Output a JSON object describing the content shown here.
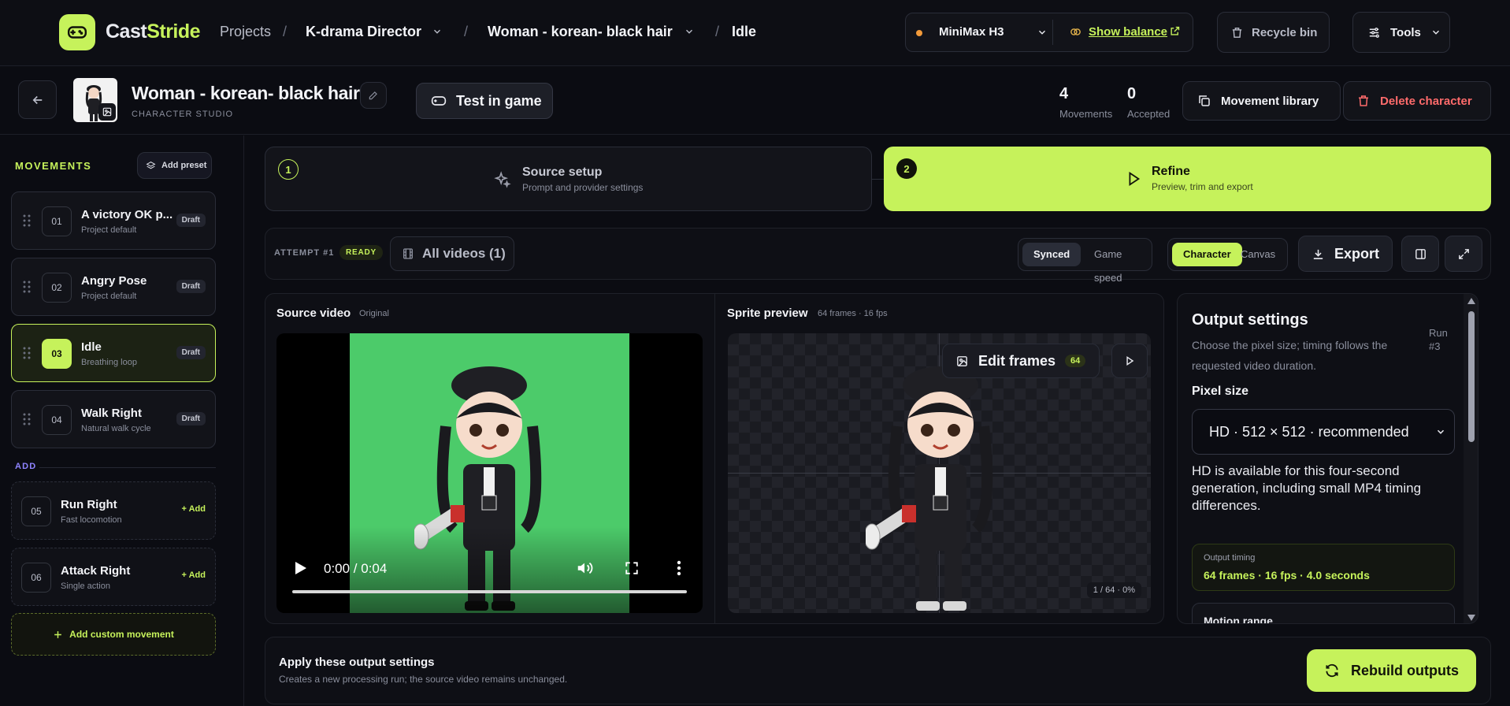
{
  "brand": {
    "part1": "Cast",
    "part2": "Stride"
  },
  "breadcrumb": {
    "projects": "Projects",
    "project": "K-drama Director",
    "character": "Woman - korean- black hair",
    "movement": "Idle"
  },
  "topbar": {
    "model": "MiniMax H3",
    "balance": "Show balance",
    "recycle": "Recycle bin",
    "tools": "Tools"
  },
  "character": {
    "name": "Woman - korean- black hair",
    "subtitle": "CHARACTER STUDIO",
    "test": "Test in game",
    "movements_count": "4",
    "movements_label": "Movements",
    "accepted_count": "0",
    "accepted_label": "Accepted",
    "library": "Movement library",
    "delete": "Delete character"
  },
  "sidebar": {
    "title": "MOVEMENTS",
    "add_preset": "Add preset",
    "items": [
      {
        "num": "01",
        "title": "A victory OK p...",
        "sub": "Project default",
        "tag": "Draft"
      },
      {
        "num": "02",
        "title": "Angry Pose",
        "sub": "Project default",
        "tag": "Draft"
      },
      {
        "num": "03",
        "title": "Idle",
        "sub": "Breathing loop",
        "tag": "Draft"
      },
      {
        "num": "04",
        "title": "Walk Right",
        "sub": "Natural walk cycle",
        "tag": "Draft"
      }
    ],
    "add_title": "ADD",
    "add_items": [
      {
        "num": "05",
        "title": "Run Right",
        "sub": "Fast locomotion",
        "add": "Add"
      },
      {
        "num": "06",
        "title": "Attack Right",
        "sub": "Single action",
        "add": "Add"
      }
    ],
    "custom": "Add custom movement"
  },
  "steps": [
    {
      "num": "1",
      "title": "Source setup",
      "sub": "Prompt and provider settings"
    },
    {
      "num": "2",
      "title": "Refine",
      "sub": "Preview, trim and export"
    }
  ],
  "toolbar": {
    "attempt": "ATTEMPT #1",
    "status": "READY",
    "videos": "All videos (1)",
    "synced": "Synced",
    "game_speed": "Game speed",
    "character": "Character",
    "canvas": "Canvas",
    "export": "Export"
  },
  "source": {
    "title": "Source video",
    "badge": "Original",
    "time": "0:00 / 0:04"
  },
  "sprite": {
    "title": "Sprite preview",
    "meta": "64 frames · 16 fps",
    "edit": "Edit frames",
    "edit_count": "64",
    "frame": "1 / 64 · 0%"
  },
  "output": {
    "title": "Output settings",
    "desc": "Choose the pixel size; timing follows the requested video duration.",
    "run": "Run #3",
    "pixel_label": "Pixel size",
    "pixel_value": "HD · 512 × 512 · recommended",
    "note": "HD is available for this four-second generation, including small MP4 timing differences.",
    "timing_label": "Output timing",
    "timing_value": "64 frames · 16 fps · 4.0 seconds",
    "motion": "Motion range"
  },
  "apply": {
    "title": "Apply these output settings",
    "sub": "Creates a new processing run; the source video remains unchanged.",
    "rebuild": "Rebuild outputs"
  },
  "colors": {
    "accent": "#c6f25b",
    "background": "#0b0c12",
    "danger": "#ff6b6b",
    "video_green": "#4ccb6a"
  },
  "icons": [
    "gamepad-icon",
    "chevron-down-icon",
    "link-icon",
    "external-link-icon",
    "trash-icon",
    "sliders-icon",
    "back-arrow-icon",
    "image-icon",
    "pencil-icon",
    "copy-icon",
    "grip-icon",
    "layers-icon",
    "plus-icon",
    "sparkle-icon",
    "play-icon",
    "film-icon",
    "download-icon",
    "sidebar-icon",
    "expand-icon",
    "volume-icon",
    "fullscreen-icon",
    "more-vertical-icon",
    "refresh-icon"
  ]
}
